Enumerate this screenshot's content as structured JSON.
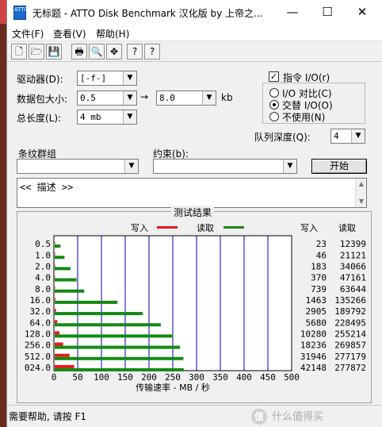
{
  "window": {
    "title": "无标题 - ATTO Disk Benchmark 汉化版 by 上帝之...",
    "icon_label": "ATTO",
    "controls": {
      "minimize": "—",
      "maximize": "☐",
      "close": "✕"
    }
  },
  "menu": {
    "file": "文件(F)",
    "view": "查看(V)",
    "help": "帮助(H)"
  },
  "toolbar": {
    "icons": [
      "new-icon",
      "open-icon",
      "save-icon",
      "print-icon",
      "print-preview-icon",
      "move-icon",
      "help-icon",
      "context-help-icon"
    ],
    "glyphs": [
      "🗋",
      "🗁",
      "💾",
      "🖶",
      "🔍",
      "✥",
      "?",
      "?"
    ]
  },
  "settings": {
    "drive_label": "驱动器(D):",
    "drive_value": "[-f-]",
    "packet_label": "数据包大小:",
    "packet_from": "0.5",
    "arrow": "→",
    "packet_to": "8.0",
    "packet_unit": "kb",
    "length_label": "总长度(L):",
    "length_value": "4 mb",
    "direct_io_label": "指令 I/O(r)",
    "direct_io_checked": true,
    "io_compare_label": "I/O 对比(C)",
    "io_overlap_label": "交替 I/O(O)",
    "io_none_label": "不使用(N)",
    "queue_label": "队列深度(Q):",
    "queue_value": "4",
    "stripe_label": "条纹群组",
    "stripe_value": "",
    "constraint_label": "约束(b):",
    "constraint_value": "",
    "start_button": "开始",
    "description_text": "<< 描述 >>"
  },
  "results": {
    "title": "测试结果",
    "legend_write": "写入",
    "legend_read": "读取",
    "col_write": "写入",
    "col_read": "读取",
    "xlabel": "传输速率 - MB / 秒"
  },
  "chart_data": {
    "type": "bar",
    "orientation": "horizontal",
    "categories": [
      "0.5",
      "1.0",
      "2.0",
      "4.0",
      "8.0",
      "16.0",
      "32.0",
      "64.0",
      "128.0",
      "256.0",
      "512.0",
      "024.0"
    ],
    "series": [
      {
        "name": "写入",
        "color": "#e8191a",
        "values": [
          23,
          46,
          183,
          370,
          739,
          1463,
          2905,
          5680,
          10280,
          18236,
          31946,
          42148
        ]
      },
      {
        "name": "读取",
        "color": "#138a13",
        "values": [
          12399,
          21121,
          34066,
          47161,
          63644,
          135266,
          189792,
          228495,
          255214,
          269857,
          277179,
          277872
        ]
      }
    ],
    "value_unit_in_table": "KB/s",
    "xlim": [
      0,
      500
    ],
    "xticks": [
      0,
      50,
      100,
      150,
      200,
      250,
      300,
      350,
      400,
      450,
      500
    ],
    "xlabel": "传输速率 - MB / 秒",
    "grid": true
  },
  "status": {
    "text": "需要帮助, 请按 F1",
    "watermark": "什么值得买",
    "badge": "值"
  }
}
